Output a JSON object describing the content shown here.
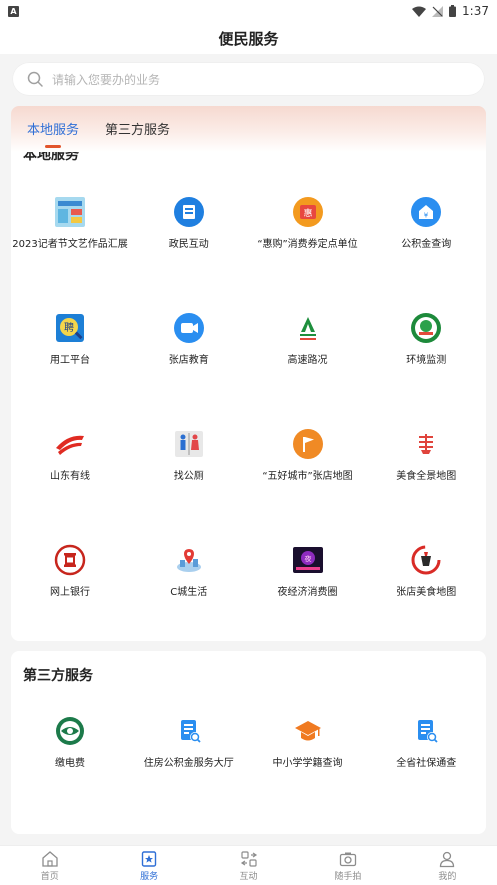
{
  "status": {
    "time": "1:37",
    "left_badge": "A"
  },
  "header": {
    "title": "便民服务"
  },
  "search": {
    "placeholder": "请输入您要办的业务"
  },
  "tabs": [
    {
      "label": "本地服务",
      "active": true
    },
    {
      "label": "第三方服务",
      "active": false
    }
  ],
  "local": {
    "title": "本地服务",
    "items": [
      {
        "label": "2023记者节文艺作品汇展",
        "icon": "journalist-festival-icon"
      },
      {
        "label": "政民互动",
        "icon": "gov-interaction-icon"
      },
      {
        "label": "“惠购”消费券定点单位",
        "icon": "coupon-icon"
      },
      {
        "label": "公积金查询",
        "icon": "housing-fund-icon"
      },
      {
        "label": "用工平台",
        "icon": "hiring-icon"
      },
      {
        "label": "张店教育",
        "icon": "education-video-icon"
      },
      {
        "label": "高速路况",
        "icon": "highway-icon"
      },
      {
        "label": "环境监测",
        "icon": "environment-icon"
      },
      {
        "label": "山东有线",
        "icon": "cable-tv-icon"
      },
      {
        "label": "找公厕",
        "icon": "toilet-icon"
      },
      {
        "label": "“五好城市”张店地图",
        "icon": "city-map-flag-icon"
      },
      {
        "label": "美食全景地图",
        "icon": "food-map-icon"
      },
      {
        "label": "网上银行",
        "icon": "bank-icon"
      },
      {
        "label": "C城生活",
        "icon": "city-life-icon"
      },
      {
        "label": "夜经济消费圈",
        "icon": "night-economy-icon"
      },
      {
        "label": "张店美食地图",
        "icon": "zhangdian-food-icon"
      }
    ]
  },
  "third": {
    "title": "第三方服务",
    "items": [
      {
        "label": "缴电费",
        "icon": "electricity-icon"
      },
      {
        "label": "住房公积金服务大厅",
        "icon": "housing-fund-hall-icon"
      },
      {
        "label": "中小学学籍查询",
        "icon": "student-status-icon"
      },
      {
        "label": "全省社保通查",
        "icon": "social-security-icon"
      }
    ]
  },
  "nav": [
    {
      "label": "首页",
      "icon": "home-icon",
      "active": false
    },
    {
      "label": "服务",
      "icon": "service-icon",
      "active": true
    },
    {
      "label": "互动",
      "icon": "interaction-icon",
      "active": false
    },
    {
      "label": "随手拍",
      "icon": "camera-icon",
      "active": false
    },
    {
      "label": "我的",
      "icon": "profile-icon",
      "active": false
    }
  ],
  "colors": {
    "accent": "#2f6fd6",
    "tab_indicator": "#e2552c",
    "background": "#f4f4f4"
  }
}
